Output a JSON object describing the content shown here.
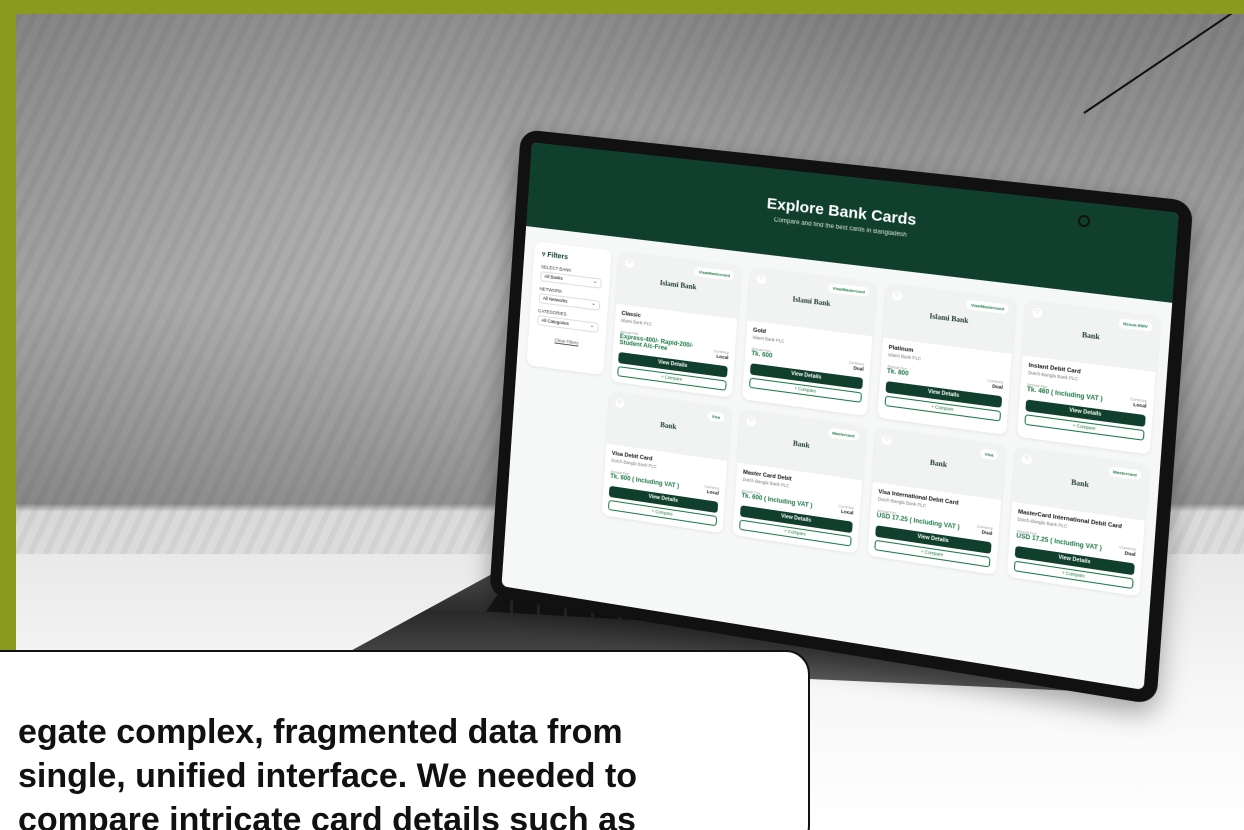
{
  "callout": {
    "text": "egate complex, fragmented data from\n single, unified interface. We needed to\ncompare intricate card details such as"
  },
  "screen": {
    "hero": {
      "title": "Explore Bank Cards",
      "subtitle": "Compare and find the best cards in Bangladesh"
    },
    "filters": {
      "title": "Filters",
      "bank_label": "SELECT BANK",
      "bank_value": "All Banks",
      "network_label": "NETWORK",
      "network_value": "All Networks",
      "category_label": "CATEGORIES",
      "category_value": "All Categories",
      "clear": "Clear Filters"
    },
    "cards": [
      {
        "badge": "Visa/Mastercard",
        "logo": "Islami Bank",
        "name": "Classic",
        "bank": "Islami Bank PLC",
        "fee_label": "Annual Fee",
        "fee": "Express-400/- Rapid-200/- Student A/c-Free",
        "cur_label": "Currency",
        "cur": "Local",
        "view": "View Details",
        "compare": "+ Compare"
      },
      {
        "badge": "Visa/Mastercard",
        "logo": "Islami Bank",
        "name": "Gold",
        "bank": "Islami Bank PLC",
        "fee_label": "Annual Fee",
        "fee": "Tk. 600",
        "cur_label": "Currency",
        "cur": "Dual",
        "view": "View Details",
        "compare": "+ Compare"
      },
      {
        "badge": "Visa/Mastercard",
        "logo": "Islami Bank",
        "name": "Platinum",
        "bank": "Islami Bank PLC",
        "fee_label": "Annual Fee",
        "fee": "Tk. 800",
        "cur_label": "Currency",
        "cur": "Dual",
        "view": "View Details",
        "compare": "+ Compare"
      },
      {
        "badge": "Nexus-EMV",
        "logo": "Bank",
        "name": "Instant Debit Card",
        "bank": "Dutch-Bangla Bank PLC",
        "fee_label": "Annual Fee",
        "fee": "Tk. 460 ( Including VAT )",
        "cur_label": "Currency",
        "cur": "Local",
        "view": "View Details",
        "compare": "+ Compare"
      },
      {
        "badge": "Visa",
        "logo": "Bank",
        "name": "Visa Debit Card",
        "bank": "Dutch-Bangla Bank PLC",
        "fee_label": "Annual Fee",
        "fee": "Tk. 600 ( Including VAT )",
        "cur_label": "Currency",
        "cur": "Local",
        "view": "View Details",
        "compare": "+ Compare"
      },
      {
        "badge": "Mastercard",
        "logo": "Bank",
        "name": "Master Card Debit",
        "bank": "Dutch-Bangla Bank PLC",
        "fee_label": "Annual Fee",
        "fee": "Tk. 600 ( Including VAT )",
        "cur_label": "Currency",
        "cur": "Local",
        "view": "View Details",
        "compare": "+ Compare"
      },
      {
        "badge": "Visa",
        "logo": "Bank",
        "name": "Visa International Debit Card",
        "bank": "Dutch-Bangla Bank PLC",
        "fee_label": "Annual Fee",
        "fee": "USD 17.25 ( Including VAT )",
        "cur_label": "Currency",
        "cur": "Dual",
        "view": "View Details",
        "compare": "+ Compare"
      },
      {
        "badge": "Mastercard",
        "logo": "Bank",
        "name": "MasterCard International Debit Card",
        "bank": "Dutch-Bangla Bank PLC",
        "fee_label": "Annual Fee",
        "fee": "USD 17.25 ( Including VAT )",
        "cur_label": "Currency",
        "cur": "Dual",
        "view": "View Details",
        "compare": "+ Compare"
      }
    ]
  },
  "colors": {
    "frame": "#8a9a1e",
    "brand": "#10402d",
    "accent": "#1a7a44"
  }
}
